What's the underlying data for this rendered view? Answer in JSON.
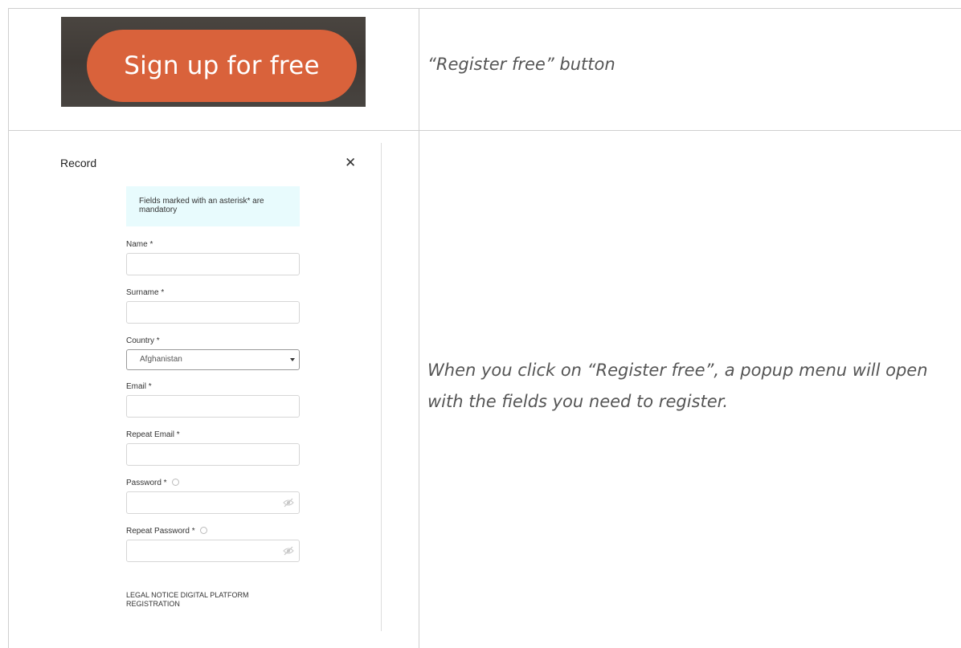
{
  "row1": {
    "signup_button_label": "Sign up for free",
    "caption": "“Register free” button"
  },
  "row2": {
    "caption": "When you click on “Register free”, a popup menu will open with the fields you need to register."
  },
  "modal": {
    "title": "Record",
    "close_icon": "close-icon",
    "notice": "Fields marked with an asterisk* are mandatory",
    "fields": {
      "name_label": "Name *",
      "surname_label": "Surname *",
      "country_label": "Country *",
      "country_value": "Afghanistan",
      "email_label": "Email *",
      "repeat_email_label": "Repeat Email *",
      "password_label": "Password *",
      "repeat_password_label": "Repeat Password *"
    },
    "legal_notice": "LEGAL NOTICE DIGITAL PLATFORM REGISTRATION"
  },
  "colors": {
    "signup_button": "#d9623b",
    "notice_background": "#e8fbfd"
  }
}
